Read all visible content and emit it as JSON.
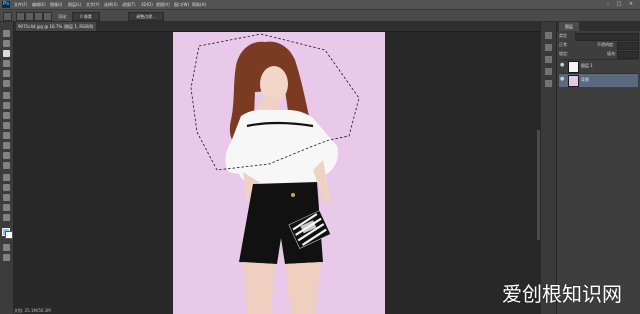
{
  "app": {
    "logo": "Ps"
  },
  "menubar": {
    "items": [
      "文件(F)",
      "编辑(E)",
      "图像(I)",
      "图层(L)",
      "文字(Y)",
      "选择(S)",
      "滤镜(T)",
      "3D(D)",
      "视图(V)",
      "窗口(W)",
      "帮助(H)"
    ]
  },
  "window_controls": {
    "minimize": "–",
    "maximize": "□",
    "close": "×"
  },
  "options": {
    "feather_label": "羽化:",
    "feather_value": "0 像素",
    "refine_edge": "调整边缘..."
  },
  "document": {
    "tab_title": "9071c4d.jpg @ 16.7% (图层 1, RGB/8)",
    "status": "文档: 25.1M/50.3M"
  },
  "panel": {
    "tab_label": "图层",
    "kind_label": "类型",
    "blend_mode": "正常",
    "opacity_label": "不透明度:",
    "lock_label": "锁定:",
    "fill_label": "填充:",
    "layers": [
      {
        "name": "图层 1",
        "selected": false
      },
      {
        "name": "背景",
        "selected": true
      }
    ]
  },
  "colors": {
    "foreground": "#79c8ff",
    "background": "#ffffff",
    "canvas_bg": "#e9c9e9",
    "accent": "#31a8ff"
  },
  "watermark": "爱创根知识网"
}
